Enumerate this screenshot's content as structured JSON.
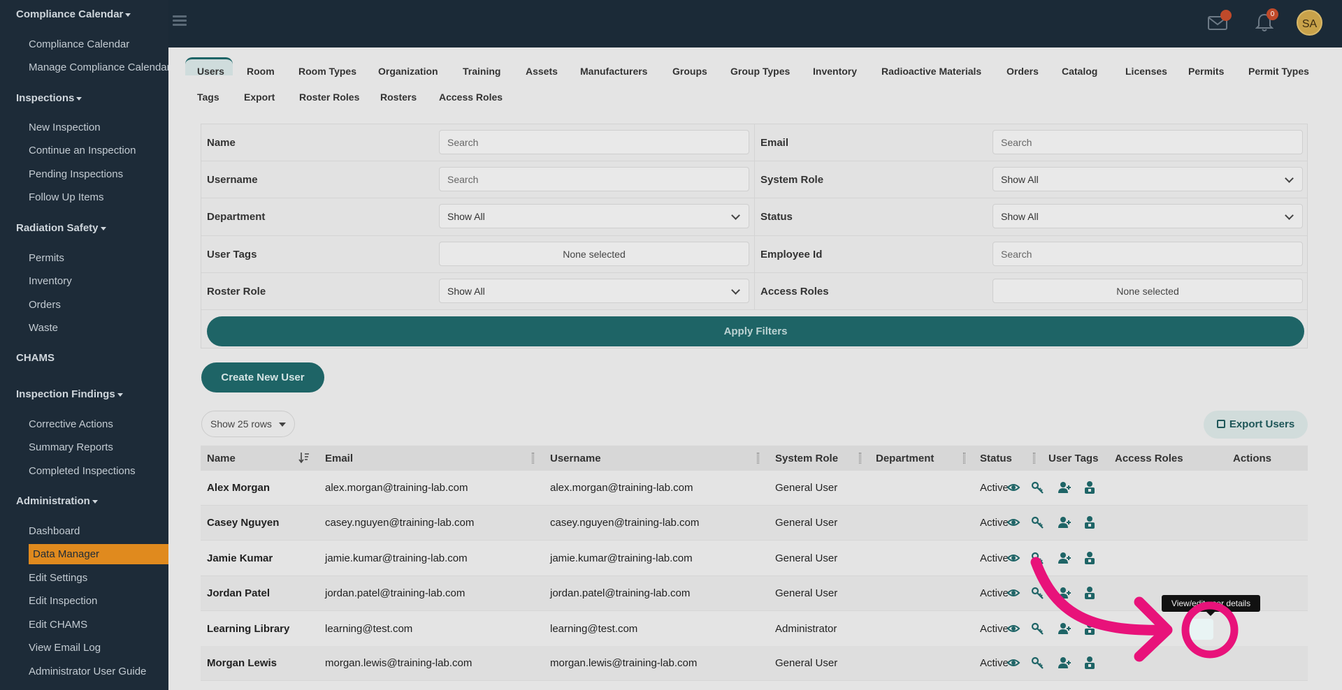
{
  "sidebar": {
    "sections": [
      {
        "title": "Compliance Calendar",
        "items": [
          "Compliance Calendar",
          "Manage Compliance Calendar"
        ]
      },
      {
        "title": "Inspections",
        "items": [
          "New Inspection",
          "Continue an Inspection",
          "Pending Inspections",
          "Follow Up Items"
        ]
      },
      {
        "title": "Radiation Safety",
        "items": [
          "Permits",
          "Inventory",
          "Orders",
          "Waste"
        ]
      },
      {
        "title": "CHAMS",
        "items": []
      },
      {
        "title": "Inspection Findings",
        "items": [
          "Corrective Actions",
          "Summary Reports",
          "Completed Inspections"
        ]
      },
      {
        "title": "Administration",
        "items": [
          "Dashboard",
          "Data Manager",
          "Edit Settings",
          "Edit Inspection",
          "Edit CHAMS",
          "View Email Log",
          "Administrator User Guide"
        ]
      }
    ],
    "active_item": "Data Manager"
  },
  "topbar": {
    "bell_count": "0",
    "avatar_initials": "SA"
  },
  "tabs": {
    "row1": [
      "Users",
      "Room",
      "Room Types",
      "Organization",
      "Training",
      "Assets",
      "Manufacturers",
      "Groups",
      "Group Types",
      "Inventory",
      "Radioactive Materials",
      "Orders",
      "Catalog",
      "Licenses",
      "Permits",
      "Permit Types"
    ],
    "row2": [
      "Tags",
      "Export",
      "Roster Roles",
      "Rosters",
      "Access Roles"
    ],
    "active": "Users"
  },
  "filters": {
    "name_label": "Name",
    "name_placeholder": "Search",
    "email_label": "Email",
    "email_placeholder": "Search",
    "username_label": "Username",
    "username_placeholder": "Search",
    "system_role_label": "System Role",
    "system_role_value": "Show All",
    "department_label": "Department",
    "department_value": "Show All",
    "status_label": "Status",
    "status_value": "Show All",
    "user_tags_label": "User Tags",
    "user_tags_value": "None selected",
    "employee_id_label": "Employee Id",
    "employee_id_placeholder": "Search",
    "roster_role_label": "Roster Role",
    "roster_role_value": "Show All",
    "access_roles_label": "Access Roles",
    "access_roles_value": "None selected",
    "apply_label": "Apply Filters"
  },
  "actions": {
    "create_label": "Create New User",
    "rows_label": "Show 25 rows",
    "export_label": "Export Users"
  },
  "table": {
    "headers": {
      "name": "Name",
      "email": "Email",
      "username": "Username",
      "system_role": "System Role",
      "department": "Department",
      "status": "Status",
      "user_tags": "User Tags",
      "access_roles": "Access Roles",
      "actions": "Actions"
    },
    "rows": [
      {
        "name": "Alex Morgan",
        "email": "alex.morgan@training-lab.com",
        "username": "alex.morgan@training-lab.com",
        "system_role": "General User",
        "status": "Active"
      },
      {
        "name": "Casey Nguyen",
        "email": "casey.nguyen@training-lab.com",
        "username": "casey.nguyen@training-lab.com",
        "system_role": "General User",
        "status": "Active"
      },
      {
        "name": "Jamie Kumar",
        "email": "jamie.kumar@training-lab.com",
        "username": "jamie.kumar@training-lab.com",
        "system_role": "General User",
        "status": "Active"
      },
      {
        "name": "Jordan Patel",
        "email": "jordan.patel@training-lab.com",
        "username": "jordan.patel@training-lab.com",
        "system_role": "General User",
        "status": "Active"
      },
      {
        "name": "Learning Library",
        "email": "learning@test.com",
        "username": "learning@test.com",
        "system_role": "Administrator",
        "status": "Active"
      },
      {
        "name": "Morgan Lewis",
        "email": "morgan.lewis@training-lab.com",
        "username": "morgan.lewis@training-lab.com",
        "system_role": "General User",
        "status": "Active"
      }
    ]
  },
  "tooltip": "View/edit user details",
  "colors": {
    "sidebar_bg": "#1d2b38",
    "accent_teal": "#1e6466",
    "active_orange": "#e08a1e",
    "annotation_pink": "#e8127a"
  }
}
